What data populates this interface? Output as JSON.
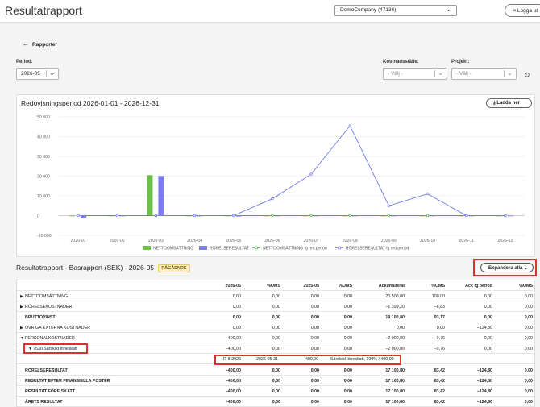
{
  "app": {
    "title": "Resultatrapport"
  },
  "company": {
    "selected": "DemoCompany (47136)"
  },
  "logout": {
    "label": "Logga ut"
  },
  "nav": {
    "back_label": "Rapporter"
  },
  "filters": {
    "period_label": "Period:",
    "period_value": "2026-05",
    "cost_center_label": "Kostnadsställe:",
    "cost_center_placeholder": "- Välj -",
    "project_label": "Projekt:",
    "project_placeholder": "- Välj -"
  },
  "chart": {
    "title": "Redovisningsperiod 2026-01-01 - 2026-12-31",
    "download_label": "Ladda ner"
  },
  "chart_data": {
    "type": "bar",
    "categories": [
      "2026-01",
      "2026-02",
      "2026-03",
      "2026-04",
      "2026-05",
      "2026-06",
      "2026-07",
      "2026-08",
      "2026-09",
      "2026-10",
      "2026-11",
      "2026-12"
    ],
    "ylim": [
      -10000,
      50000
    ],
    "yticks": [
      -10000,
      0,
      10000,
      20000,
      30000,
      40000,
      50000
    ],
    "ytick_labels": [
      "-10 000",
      "0",
      "10 000",
      "20 000",
      "30 000",
      "40 000",
      "50 000"
    ],
    "grid": true,
    "legend_position": "bottom",
    "series": [
      {
        "name": "NETTOOMSÄTTNING",
        "kind": "bar",
        "color": "#6cc04a",
        "values": [
          0,
          0,
          20500,
          0,
          0,
          0,
          0,
          0,
          0,
          0,
          0,
          0
        ]
      },
      {
        "name": "RÖRELSERESULTAT",
        "kind": "bar",
        "color": "#7b7cf0",
        "values": [
          -1400,
          0,
          20100,
          0,
          -400,
          0,
          0,
          0,
          0,
          0,
          0,
          0
        ]
      },
      {
        "name": "NETTOOMSÄTTNING fg red.period",
        "kind": "line",
        "color": "#4bb04b",
        "values": [
          0,
          0,
          0,
          0,
          0,
          0,
          0,
          0,
          0,
          0,
          0,
          0
        ]
      },
      {
        "name": "RÖRELSERESULTAT fg red.period",
        "kind": "line",
        "color": "#6f7ae6",
        "values": [
          0,
          0,
          0,
          0,
          0,
          8500,
          21000,
          45500,
          5000,
          11000,
          0,
          0
        ]
      }
    ]
  },
  "report": {
    "title": "Resultatrapport  -  Basrapport (SEK)  -  2026-05",
    "status": "PÅGÅENDE",
    "expand_label": "Expandera alla",
    "columns": [
      "2026-05",
      "%OMS",
      "2025-05",
      "%OMS",
      "Ackumulerat",
      "%OMS",
      "Ack fg period",
      "%OMS"
    ],
    "rows": [
      {
        "label": "NETTOOMSÄTTNING",
        "arrow": "▶",
        "values": [
          "0,00",
          "0,00",
          "0,00",
          "0,00",
          "20 500,00",
          "100,00",
          "0,00",
          "0,00"
        ]
      },
      {
        "label": "RÖRELSEKOSTNADER",
        "arrow": "▶",
        "values": [
          "0,00",
          "0,00",
          "0,00",
          "0,00",
          "−1 399,20",
          "−6,83",
          "0,00",
          "0,00"
        ]
      },
      {
        "label": "BRUTTOVINST",
        "arrow": "",
        "values": [
          "0,00",
          "0,00",
          "0,00",
          "0,00",
          "19 100,80",
          "93,17",
          "0,00",
          "0,00"
        ]
      },
      {
        "label": "ÖVRIGA EXTERNA KOSTNADER",
        "arrow": "▶",
        "values": [
          "0,00",
          "0,00",
          "0,00",
          "0,00",
          "0,00",
          "0,00",
          "−124,80",
          "0,00"
        ]
      },
      {
        "label": "PERSONALKOSTNADER",
        "arrow": "▼",
        "values": [
          "−400,00",
          "0,00",
          "0,00",
          "0,00",
          "−2 000,00",
          "−9,76",
          "0,00",
          "0,00"
        ]
      },
      {
        "label": "7530 Särskild löneskatt",
        "arrow": "▼",
        "values": [
          "−400,00",
          "0,00",
          "0,00",
          "0,00",
          "−2 000,00",
          "−9,76",
          "0,00",
          "0,00"
        ]
      },
      {
        "label": "RÖRELSERESULTAT",
        "arrow": "",
        "values": [
          "−400,00",
          "0,00",
          "0,00",
          "0,00",
          "17 100,80",
          "83,42",
          "−124,80",
          "0,00"
        ]
      },
      {
        "label": "RESULTAT EFTER FINANSIELLA POSTER",
        "arrow": "",
        "values": [
          "−400,00",
          "0,00",
          "0,00",
          "0,00",
          "17 100,80",
          "83,42",
          "−124,80",
          "0,00"
        ]
      },
      {
        "label": "RESULTAT FÖRE SKATT",
        "arrow": "",
        "values": [
          "−400,00",
          "0,00",
          "0,00",
          "0,00",
          "17 100,80",
          "83,42",
          "−124,80",
          "0,00"
        ]
      },
      {
        "label": "ÅRETS RESULTAT",
        "arrow": "",
        "values": [
          "−400,00",
          "0,00",
          "0,00",
          "0,00",
          "17 100,80",
          "83,42",
          "−124,80",
          "0,00"
        ]
      }
    ],
    "transaction": {
      "voucher": "R-8-2026",
      "date": "2026-05-31",
      "amount": "400,00",
      "description": "Särskild löneskatt, 100% / 400,00"
    }
  }
}
